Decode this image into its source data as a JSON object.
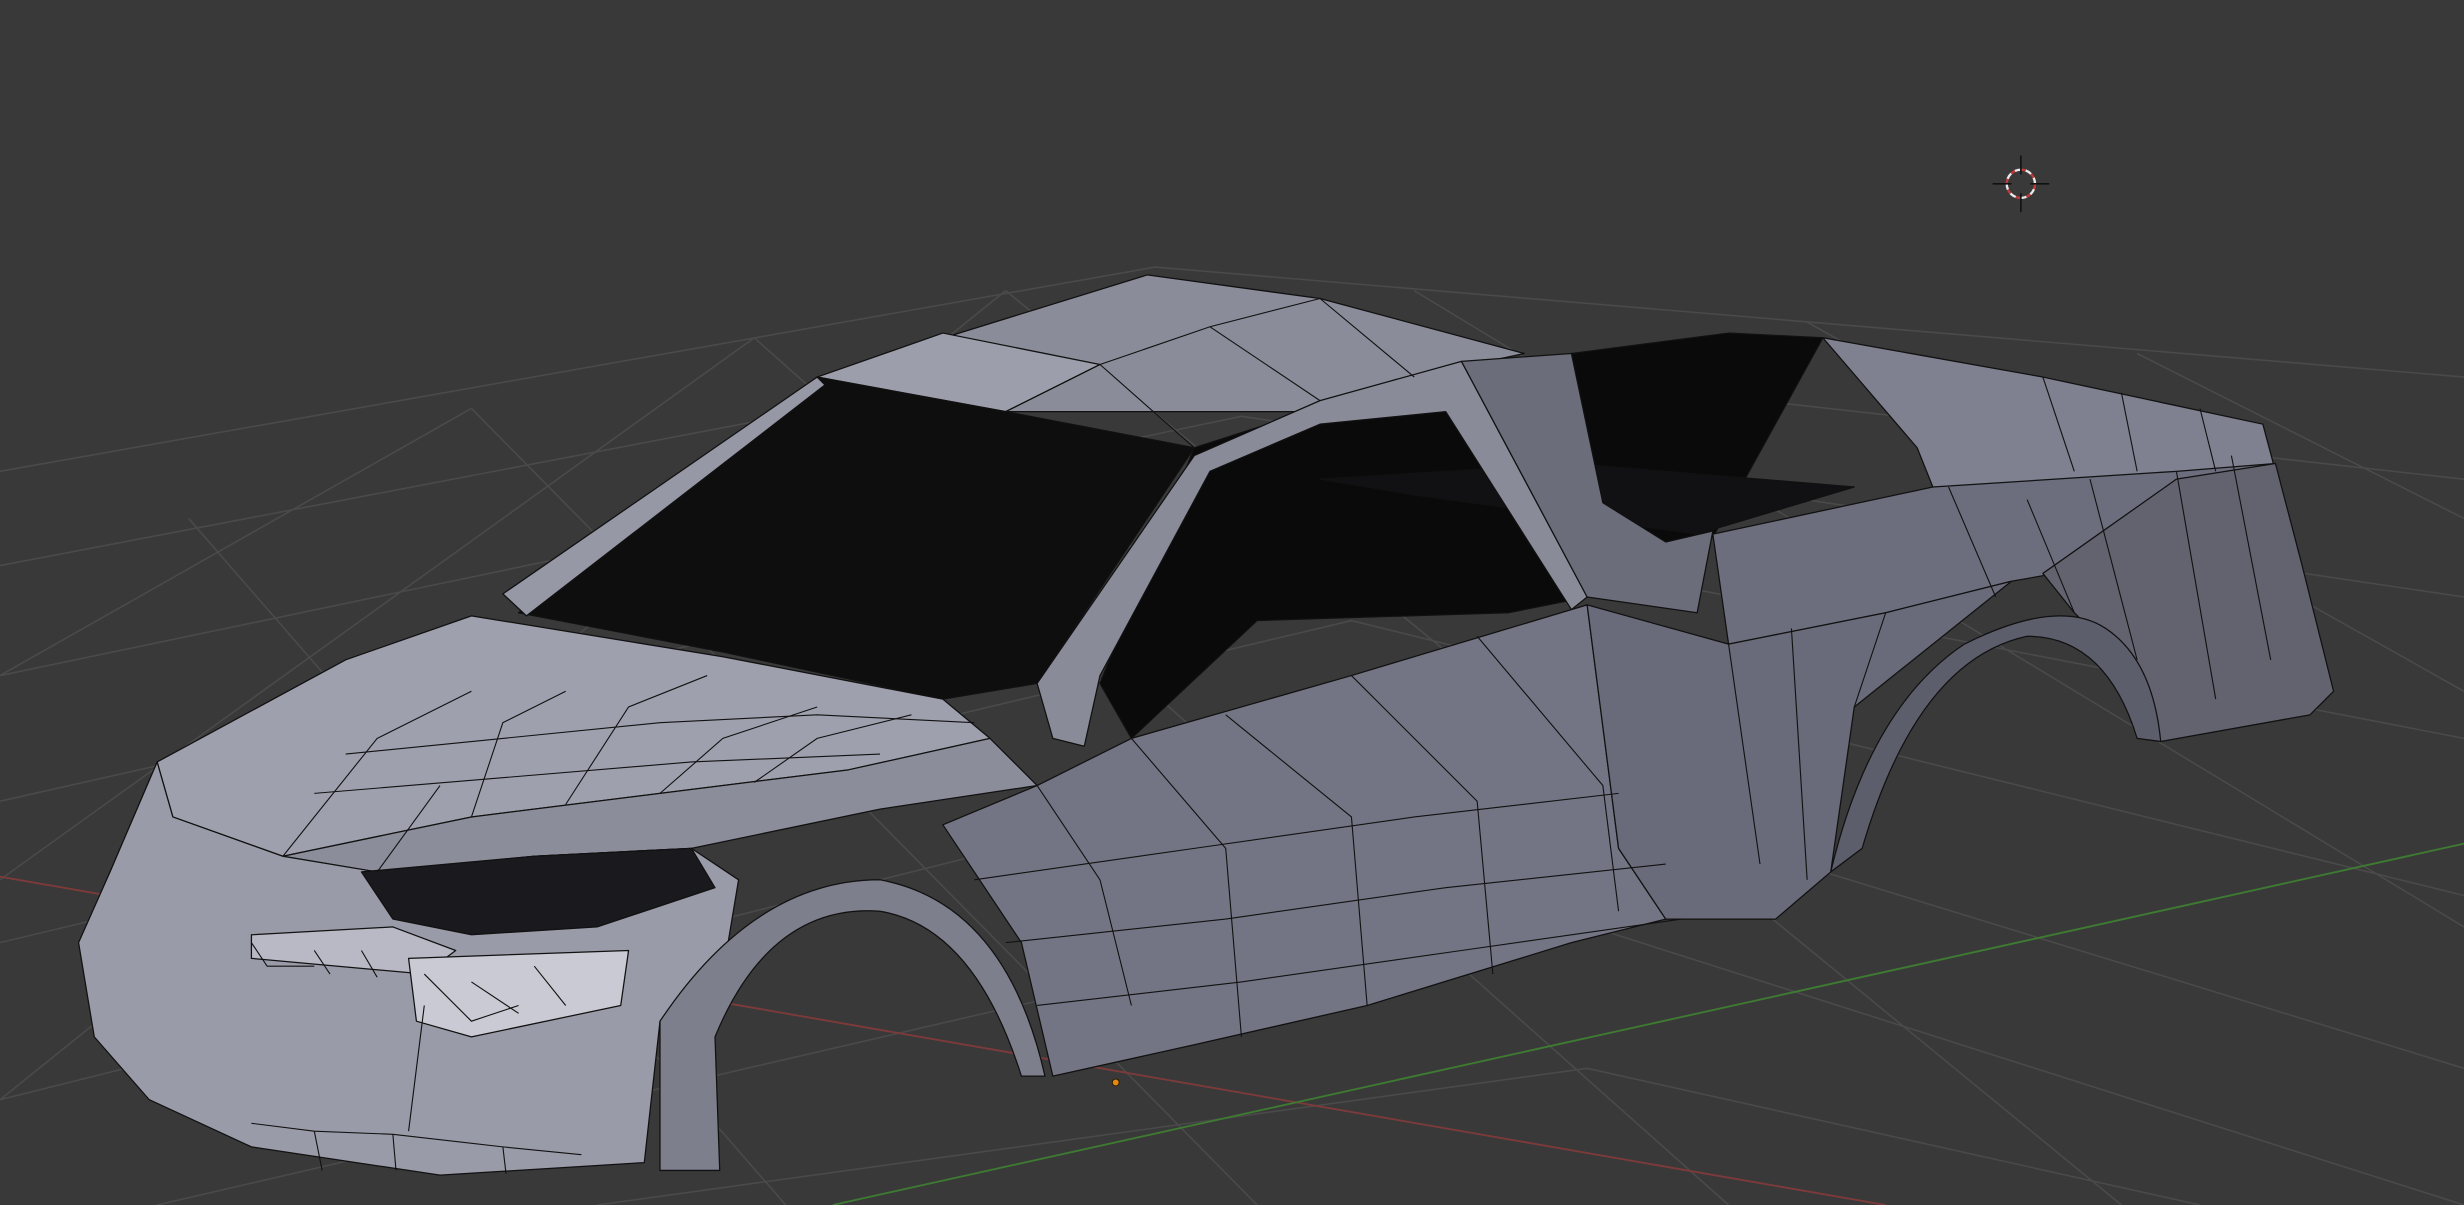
{
  "viewport": {
    "background_color": "#393939",
    "grid_color": "#4a4a4a",
    "x_axis_color": "#7d3a3a",
    "y_axis_color": "#3e7a32",
    "mesh": {
      "object_name": "",
      "face_color_light": "#a6a7b3",
      "face_color_mid": "#7c7d8c",
      "face_color_dark": "#5b5c6a",
      "edge_color": "#111111",
      "glass_color": "#0c0c0c"
    },
    "cursor_3d": {
      "icon": "crosshair-target-icon",
      "ring_color": "#c03a3a"
    },
    "origin_marker": {
      "icon": "object-origin-dot",
      "color": "#e08a12"
    }
  }
}
